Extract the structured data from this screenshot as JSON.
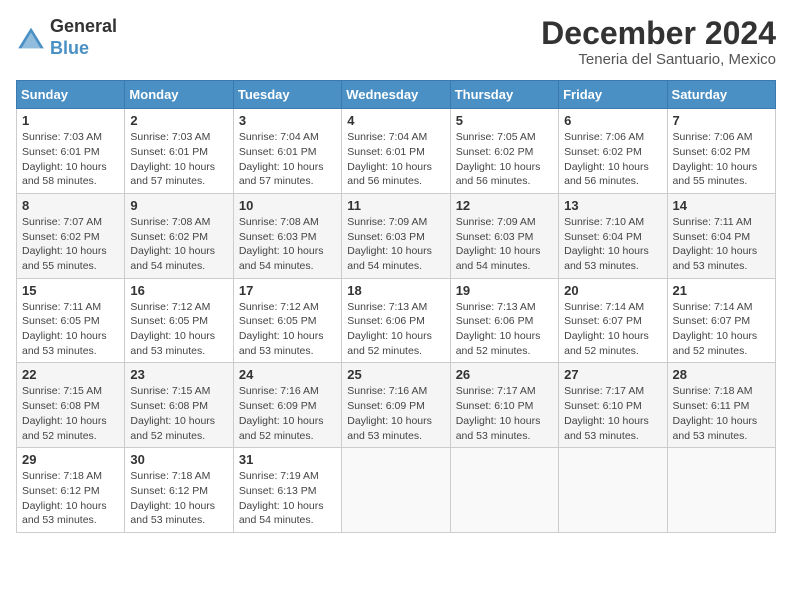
{
  "header": {
    "logo_general": "General",
    "logo_blue": "Blue",
    "month_year": "December 2024",
    "location": "Teneria del Santuario, Mexico"
  },
  "days_of_week": [
    "Sunday",
    "Monday",
    "Tuesday",
    "Wednesday",
    "Thursday",
    "Friday",
    "Saturday"
  ],
  "weeks": [
    [
      {
        "day": "1",
        "sunrise": "7:03 AM",
        "sunset": "6:01 PM",
        "daylight": "10 hours and 58 minutes."
      },
      {
        "day": "2",
        "sunrise": "7:03 AM",
        "sunset": "6:01 PM",
        "daylight": "10 hours and 57 minutes."
      },
      {
        "day": "3",
        "sunrise": "7:04 AM",
        "sunset": "6:01 PM",
        "daylight": "10 hours and 57 minutes."
      },
      {
        "day": "4",
        "sunrise": "7:04 AM",
        "sunset": "6:01 PM",
        "daylight": "10 hours and 56 minutes."
      },
      {
        "day": "5",
        "sunrise": "7:05 AM",
        "sunset": "6:02 PM",
        "daylight": "10 hours and 56 minutes."
      },
      {
        "day": "6",
        "sunrise": "7:06 AM",
        "sunset": "6:02 PM",
        "daylight": "10 hours and 56 minutes."
      },
      {
        "day": "7",
        "sunrise": "7:06 AM",
        "sunset": "6:02 PM",
        "daylight": "10 hours and 55 minutes."
      }
    ],
    [
      {
        "day": "8",
        "sunrise": "7:07 AM",
        "sunset": "6:02 PM",
        "daylight": "10 hours and 55 minutes."
      },
      {
        "day": "9",
        "sunrise": "7:08 AM",
        "sunset": "6:02 PM",
        "daylight": "10 hours and 54 minutes."
      },
      {
        "day": "10",
        "sunrise": "7:08 AM",
        "sunset": "6:03 PM",
        "daylight": "10 hours and 54 minutes."
      },
      {
        "day": "11",
        "sunrise": "7:09 AM",
        "sunset": "6:03 PM",
        "daylight": "10 hours and 54 minutes."
      },
      {
        "day": "12",
        "sunrise": "7:09 AM",
        "sunset": "6:03 PM",
        "daylight": "10 hours and 54 minutes."
      },
      {
        "day": "13",
        "sunrise": "7:10 AM",
        "sunset": "6:04 PM",
        "daylight": "10 hours and 53 minutes."
      },
      {
        "day": "14",
        "sunrise": "7:11 AM",
        "sunset": "6:04 PM",
        "daylight": "10 hours and 53 minutes."
      }
    ],
    [
      {
        "day": "15",
        "sunrise": "7:11 AM",
        "sunset": "6:05 PM",
        "daylight": "10 hours and 53 minutes."
      },
      {
        "day": "16",
        "sunrise": "7:12 AM",
        "sunset": "6:05 PM",
        "daylight": "10 hours and 53 minutes."
      },
      {
        "day": "17",
        "sunrise": "7:12 AM",
        "sunset": "6:05 PM",
        "daylight": "10 hours and 53 minutes."
      },
      {
        "day": "18",
        "sunrise": "7:13 AM",
        "sunset": "6:06 PM",
        "daylight": "10 hours and 52 minutes."
      },
      {
        "day": "19",
        "sunrise": "7:13 AM",
        "sunset": "6:06 PM",
        "daylight": "10 hours and 52 minutes."
      },
      {
        "day": "20",
        "sunrise": "7:14 AM",
        "sunset": "6:07 PM",
        "daylight": "10 hours and 52 minutes."
      },
      {
        "day": "21",
        "sunrise": "7:14 AM",
        "sunset": "6:07 PM",
        "daylight": "10 hours and 52 minutes."
      }
    ],
    [
      {
        "day": "22",
        "sunrise": "7:15 AM",
        "sunset": "6:08 PM",
        "daylight": "10 hours and 52 minutes."
      },
      {
        "day": "23",
        "sunrise": "7:15 AM",
        "sunset": "6:08 PM",
        "daylight": "10 hours and 52 minutes."
      },
      {
        "day": "24",
        "sunrise": "7:16 AM",
        "sunset": "6:09 PM",
        "daylight": "10 hours and 52 minutes."
      },
      {
        "day": "25",
        "sunrise": "7:16 AM",
        "sunset": "6:09 PM",
        "daylight": "10 hours and 53 minutes."
      },
      {
        "day": "26",
        "sunrise": "7:17 AM",
        "sunset": "6:10 PM",
        "daylight": "10 hours and 53 minutes."
      },
      {
        "day": "27",
        "sunrise": "7:17 AM",
        "sunset": "6:10 PM",
        "daylight": "10 hours and 53 minutes."
      },
      {
        "day": "28",
        "sunrise": "7:18 AM",
        "sunset": "6:11 PM",
        "daylight": "10 hours and 53 minutes."
      }
    ],
    [
      {
        "day": "29",
        "sunrise": "7:18 AM",
        "sunset": "6:12 PM",
        "daylight": "10 hours and 53 minutes."
      },
      {
        "day": "30",
        "sunrise": "7:18 AM",
        "sunset": "6:12 PM",
        "daylight": "10 hours and 53 minutes."
      },
      {
        "day": "31",
        "sunrise": "7:19 AM",
        "sunset": "6:13 PM",
        "daylight": "10 hours and 54 minutes."
      },
      null,
      null,
      null,
      null
    ]
  ]
}
